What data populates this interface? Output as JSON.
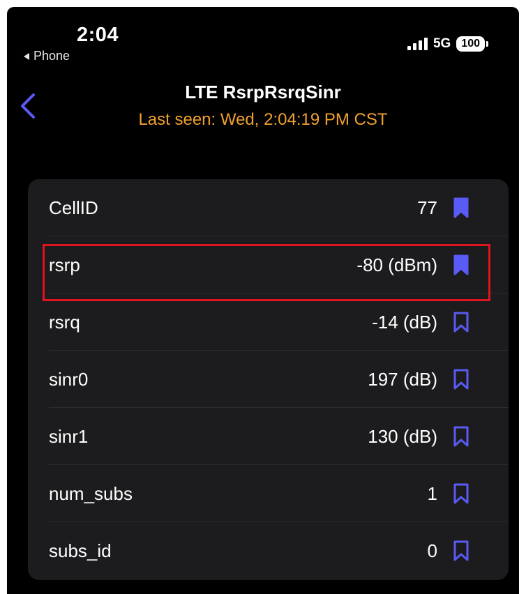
{
  "status_bar": {
    "time": "2:04",
    "back_app": "Phone",
    "network": "5G",
    "battery": "100"
  },
  "nav": {
    "title": "LTE RsrpRsrqSinr",
    "subtitle": "Last seen: Wed, 2:04:19 PM CST"
  },
  "colors": {
    "accent": "#5a5af5",
    "subtitle": "#f0a030",
    "highlight": "#e0141e"
  },
  "rows": [
    {
      "label": "CellID",
      "value": "77",
      "bookmarked": true
    },
    {
      "label": "rsrp",
      "value": "-80 (dBm)",
      "bookmarked": true
    },
    {
      "label": "rsrq",
      "value": "-14 (dB)",
      "bookmarked": false
    },
    {
      "label": "sinr0",
      "value": "197 (dB)",
      "bookmarked": false
    },
    {
      "label": "sinr1",
      "value": "130 (dB)",
      "bookmarked": false
    },
    {
      "label": "num_subs",
      "value": "1",
      "bookmarked": false
    },
    {
      "label": "subs_id",
      "value": "0",
      "bookmarked": false
    }
  ]
}
